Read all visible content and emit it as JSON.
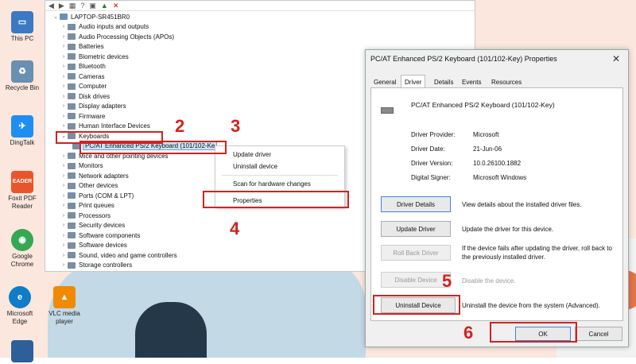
{
  "desktop_icons": [
    {
      "label": "This PC",
      "icon": "this-pc-icon",
      "color": "#3b79c4",
      "glyph": "▭"
    },
    {
      "label": "Recycle Bin",
      "icon": "recycle-bin-icon",
      "color": "#6a8fb0",
      "glyph": "♻"
    },
    {
      "label": "DingTalk",
      "icon": "dingtalk-icon",
      "color": "#1f8ef1",
      "glyph": "✈"
    },
    {
      "label": "Foxit PDF Reader",
      "icon": "foxit-icon",
      "color": "#e8552b",
      "glyph": "EADER"
    },
    {
      "label": "Google Chrome",
      "icon": "chrome-icon",
      "color": "#34a853",
      "glyph": "◉"
    },
    {
      "label": "Microsoft Edge",
      "icon": "edge-icon",
      "color": "#0f7cc8",
      "glyph": "e"
    },
    {
      "label": "VLC media player",
      "icon": "vlc-icon",
      "color": "#f08a00",
      "glyph": "▲"
    }
  ],
  "device_manager": {
    "root": "LAPTOP-SR451BR0",
    "items": [
      "Audio inputs and outputs",
      "Audio Processing Objects (APOs)",
      "Batteries",
      "Biometric devices",
      "Bluetooth",
      "Cameras",
      "Computer",
      "Disk drives",
      "Display adapters",
      "Firmware",
      "Human Interface Devices",
      "Keyboards",
      "PC/AT Enhanced PS/2 Keyboard (101/102-Ke",
      "Mice and other pointing devices",
      "Monitors",
      "Network adapters",
      "Other devices",
      "Ports (COM & LPT)",
      "Print queues",
      "Processors",
      "Security devices",
      "Software components",
      "Software devices",
      "Sound, video and game controllers",
      "Storage controllers"
    ]
  },
  "context_menu": {
    "update": "Update driver",
    "uninstall": "Uninstall device",
    "scan": "Scan for hardware changes",
    "properties": "Properties"
  },
  "steps": {
    "s2": "2",
    "s3": "3",
    "s4": "4",
    "s5": "5",
    "s6": "6"
  },
  "dialog": {
    "title": "PC/AT Enhanced PS/2 Keyboard (101/102-Key) Properties",
    "close": "✕",
    "tabs": [
      "General",
      "Driver",
      "Details",
      "Events",
      "Resources"
    ],
    "device_name": "PC/AT Enhanced PS/2 Keyboard (101/102-Key)",
    "props": [
      {
        "label": "Driver Provider:",
        "value": "Microsoft"
      },
      {
        "label": "Driver Date:",
        "value": "21-Jun-06"
      },
      {
        "label": "Driver Version:",
        "value": "10.0.26100.1882"
      },
      {
        "label": "Digital Signer:",
        "value": "Microsoft Windows"
      }
    ],
    "buttons": [
      {
        "label": "Driver Details",
        "desc": "View details about the installed driver files."
      },
      {
        "label": "Update Driver",
        "desc": "Update the driver for this device."
      },
      {
        "label": "Roll Back Driver",
        "desc": "If the device fails after updating the driver, roll back to the previously installed driver."
      },
      {
        "label": "Disable Device",
        "desc": "Disable the device."
      },
      {
        "label": "Uninstall Device",
        "desc": "Uninstall the device from the system (Advanced)."
      }
    ],
    "ok": "OK",
    "cancel": "Cancel"
  },
  "colors": {
    "accent_red": "#d1231f",
    "selection": "#cce4f7"
  }
}
